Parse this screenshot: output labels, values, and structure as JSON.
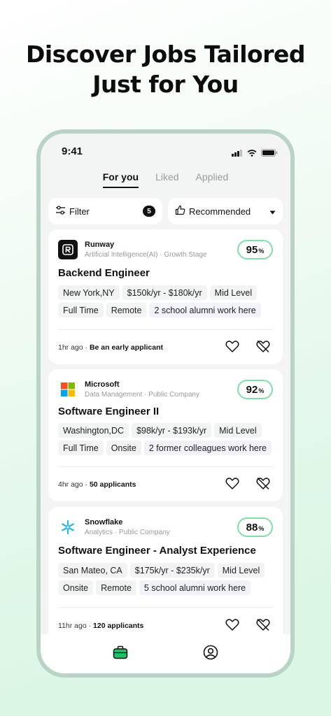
{
  "headline": {
    "line1": "Discover Jobs Tailored",
    "line2": "Just for You"
  },
  "status": {
    "time": "9:41"
  },
  "tabs": [
    {
      "label": "For you",
      "active": true
    },
    {
      "label": "Liked",
      "active": false
    },
    {
      "label": "Applied",
      "active": false
    }
  ],
  "toolbar": {
    "filter_label": "Filter",
    "filter_count": "5",
    "sort_label": "Recommended"
  },
  "jobs": [
    {
      "company": "Runway",
      "meta": "Artificial Intelligence(AI) · Growth Stage",
      "match": "95",
      "match_unit": "%",
      "title": "Backend Engineer",
      "tags": [
        "New York,NY",
        "$150k/yr - $180k/yr",
        "Mid Level",
        "Full Time",
        "Remote",
        "2 school alumni work here"
      ],
      "posted": "1hr ago ·",
      "applicants": "Be an early applicant"
    },
    {
      "company": "Microsoft",
      "meta": "Data Management · Public Company",
      "match": "92",
      "match_unit": "%",
      "title": "Software Engineer II",
      "tags": [
        "Washington,DC",
        "$98k/yr - $193k/yr",
        "Mid Level",
        "Full Time",
        "Onsite",
        "2 former colleagues work here"
      ],
      "posted": "4hr ago ·",
      "applicants": "50 applicants"
    },
    {
      "company": "Snowflake",
      "meta": "Analytics · Public Company",
      "match": "88",
      "match_unit": "%",
      "title": "Software Engineer - Analyst Experience",
      "tags": [
        "San Mateo, CA",
        "$175k/yr - $235k/yr",
        "Mid Level",
        "Onsite",
        "Remote",
        "5 school alumni work here"
      ],
      "posted": "11hr ago ·",
      "applicants": "120 applicants"
    }
  ],
  "colors": {
    "accent": "#22c168",
    "match_border": "#7ee0a4",
    "frame": "#b9d4c6"
  },
  "icons": [
    "signal-icon",
    "wifi-icon",
    "battery-icon",
    "filter-icon",
    "thumbs-up-icon",
    "caret-down-icon",
    "heart-icon",
    "not-interested-icon",
    "briefcase-icon",
    "profile-icon"
  ]
}
